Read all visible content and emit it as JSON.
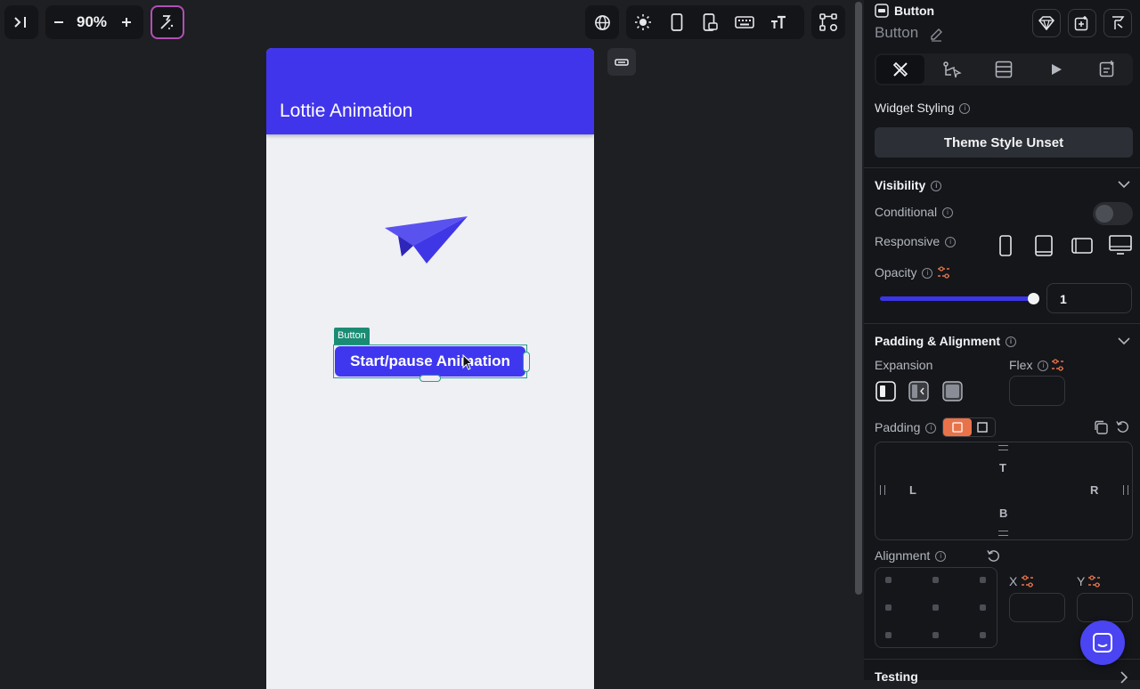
{
  "toolbar": {
    "zoom_level": "90%"
  },
  "canvas": {
    "app_title": "Lottie Animation",
    "selected_tag": "Button",
    "button_label": "Start/pause Animation"
  },
  "panel": {
    "widget_type": "Button",
    "widget_name": "Button",
    "widget_styling_label": "Widget Styling",
    "theme_style_button": "Theme Style Unset",
    "visibility": {
      "title": "Visibility",
      "conditional_label": "Conditional",
      "responsive_label": "Responsive",
      "opacity_label": "Opacity",
      "opacity_value": "1",
      "opacity_level": 1
    },
    "padding_alignment": {
      "title": "Padding & Alignment",
      "expansion_label": "Expansion",
      "flex_label": "Flex",
      "padding_label": "Padding",
      "top_letter": "T",
      "left_letter": "L",
      "right_letter": "R",
      "bottom_letter": "B",
      "alignment_label": "Alignment",
      "x_label": "X",
      "y_label": "Y"
    },
    "testing_title": "Testing"
  },
  "colors": {
    "accent": "#4135eb",
    "button": "#3f37f0",
    "selection": "#1a8c73",
    "orange": "#e8734a",
    "chat_bubble": "#4a44f2"
  }
}
